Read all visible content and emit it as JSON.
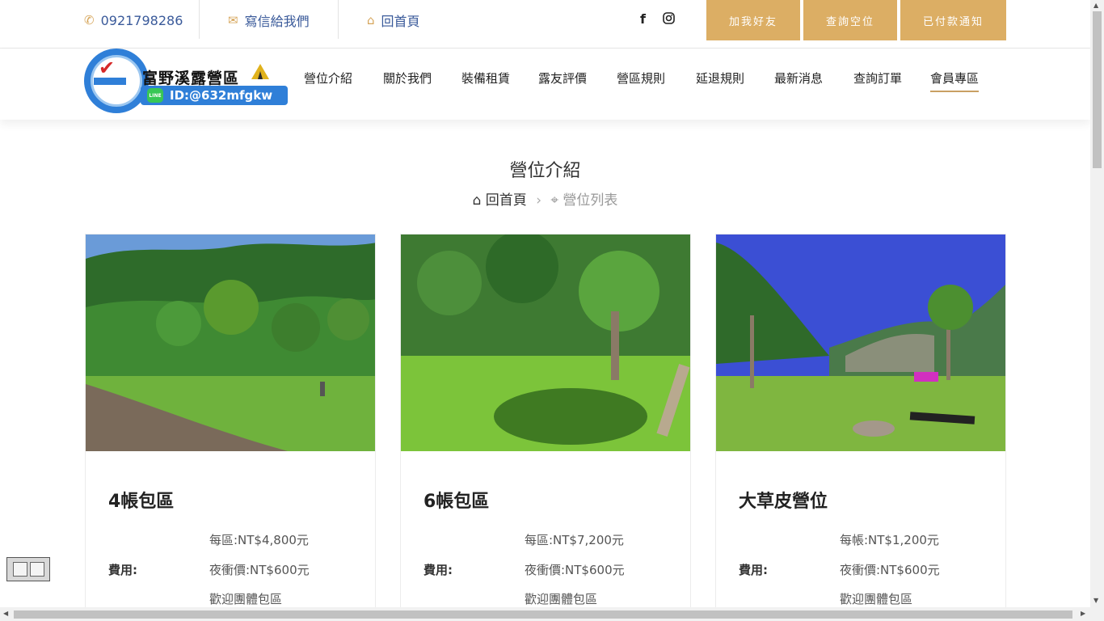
{
  "topbar": {
    "phone": "0921798286",
    "mail_label": "寫信給我們",
    "home_label": "回首頁",
    "buttons": [
      "加我好友",
      "查詢空位",
      "已付款通知"
    ],
    "social": [
      "facebook-icon",
      "instagram-icon"
    ]
  },
  "logo": {
    "title": "富野溪露營區",
    "line_id": "ID:@632mfgkw",
    "line_badge": "LINE"
  },
  "nav": {
    "items": [
      "營位介紹",
      "關於我們",
      "裝備租賃",
      "露友評價",
      "營區規則",
      "延退規則",
      "最新消息",
      "查詢訂單",
      "會員專區"
    ],
    "active": "會員專區"
  },
  "page": {
    "title": "營位介紹",
    "breadcrumb_home": "回首頁",
    "breadcrumb_current": "營位列表"
  },
  "cards": [
    {
      "title": "4帳包區",
      "fee_label": "費用:",
      "fees": [
        "每區:NT$4,800元",
        "夜衝價:NT$600元",
        "歡迎團體包區"
      ]
    },
    {
      "title": "6帳包區",
      "fee_label": "費用:",
      "fees": [
        "每區:NT$7,200元",
        "夜衝價:NT$600元",
        "歡迎團體包區"
      ]
    },
    {
      "title": "大草皮營位",
      "fee_label": "費用:",
      "fees": [
        "每帳:NT$1,200元",
        "夜衝價:NT$600元",
        "歡迎團體包區"
      ]
    }
  ],
  "colors": {
    "accent": "#dcae64",
    "link": "#3a5a9a",
    "logo_blue": "#2f7fd8",
    "line_green": "#38c755"
  }
}
